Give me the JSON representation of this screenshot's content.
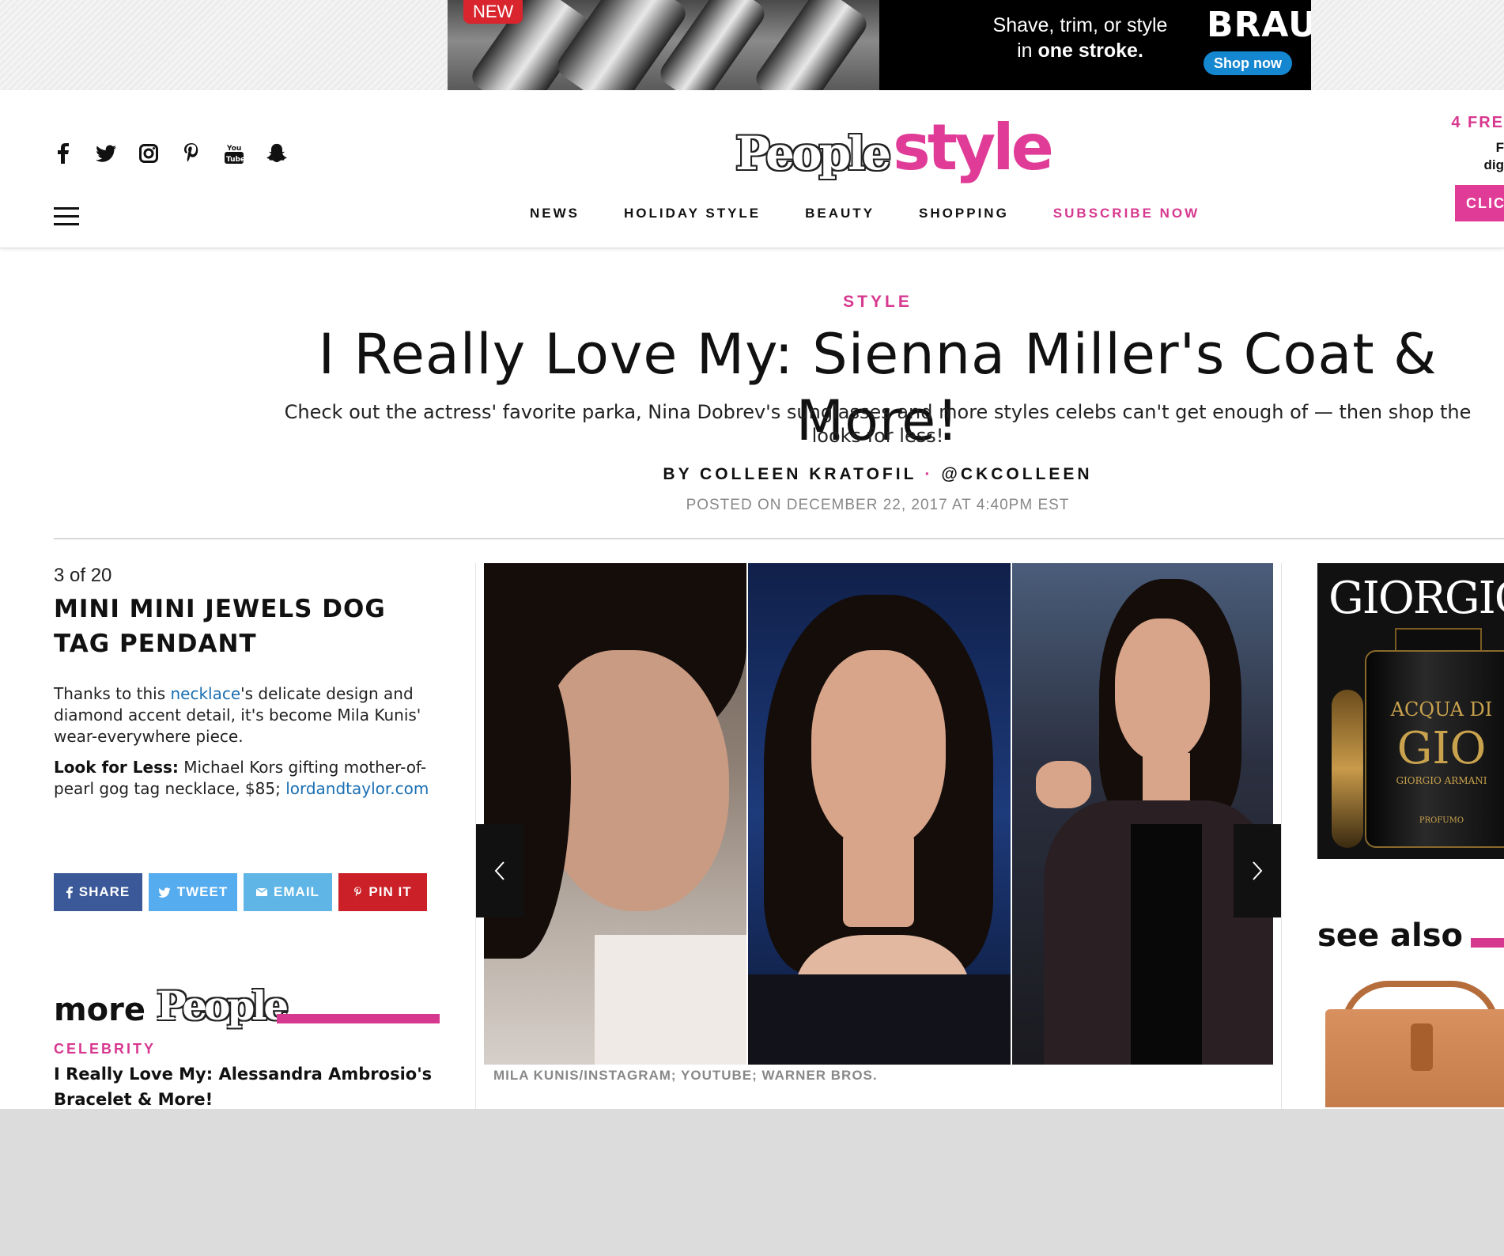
{
  "ad_top": {
    "badge": "NEW",
    "copy_line1": "Shave, trim, or style",
    "copy_line2_pre": "in ",
    "copy_line2_bold": "one stroke.",
    "brand": "BRAUN",
    "cta": "Shop now"
  },
  "header": {
    "social_icons": [
      "facebook-icon",
      "twitter-icon",
      "instagram-icon",
      "pinterest-icon",
      "youtube-icon",
      "snapchat-icon"
    ],
    "logo_people": "People",
    "logo_style": "style",
    "nav": [
      "NEWS",
      "HOLIDAY STYLE",
      "BEAUTY",
      "SHOPPING",
      "SUBSCRIBE NOW"
    ],
    "promo_text": "4 FRE",
    "promo_sub1": "F",
    "promo_sub2": "dig",
    "promo_button": "CLIC"
  },
  "article": {
    "kicker": "STYLE",
    "headline": "I Really Love My: Sienna Miller's Coat & More!",
    "dek": "Check out the actress' favorite parka, Nina Dobrev's sunglasses and more styles celebs can't get enough of — then shop the looks for less!",
    "byline_author": "BY COLLEEN KRATOFIL",
    "byline_separator": "·",
    "byline_handle": "@CKCOLLEEN",
    "posted": "POSTED ON DECEMBER 22, 2017 AT 4:40PM EST"
  },
  "slide": {
    "counter": "3 of 20",
    "title": "MINI MINI JEWELS DOG TAG PENDANT",
    "body_pre": "Thanks to this ",
    "body_link": "necklace",
    "body_post": "'s delicate design and diamond accent detail, it's become Mila Kunis' wear-everywhere piece.",
    "look_label": "Look for Less:",
    "look_text": " Michael Kors gifting mother-of-pearl gog tag necklace, $85; ",
    "look_link": "lordandtaylor.com",
    "photo_credit": "MILA KUNIS/INSTAGRAM; YOUTUBE; WARNER BROS."
  },
  "share": {
    "facebook": "SHARE",
    "twitter": "TWEET",
    "email": "EMAIL",
    "pinterest": "PIN IT"
  },
  "more_people": {
    "label": "more",
    "logo": "People",
    "kicker": "CELEBRITY",
    "title": "I Really Love My: Alessandra Ambrosio's Bracelet & More!"
  },
  "rail": {
    "ad_brand": "GIORGIO",
    "bottle_line1": "ACQUA DI",
    "bottle_line2": "GIO",
    "bottle_line3": "GIORGIO ARMANI",
    "bottle_line4": "PROFUMO",
    "see_also": "see also"
  },
  "colors": {
    "brand_pink": "#d7388f",
    "link_blue": "#1a6fb3",
    "facebook": "#3b5998",
    "twitter": "#55acee",
    "email": "#5fb6e6",
    "pinterest": "#cb2027"
  }
}
